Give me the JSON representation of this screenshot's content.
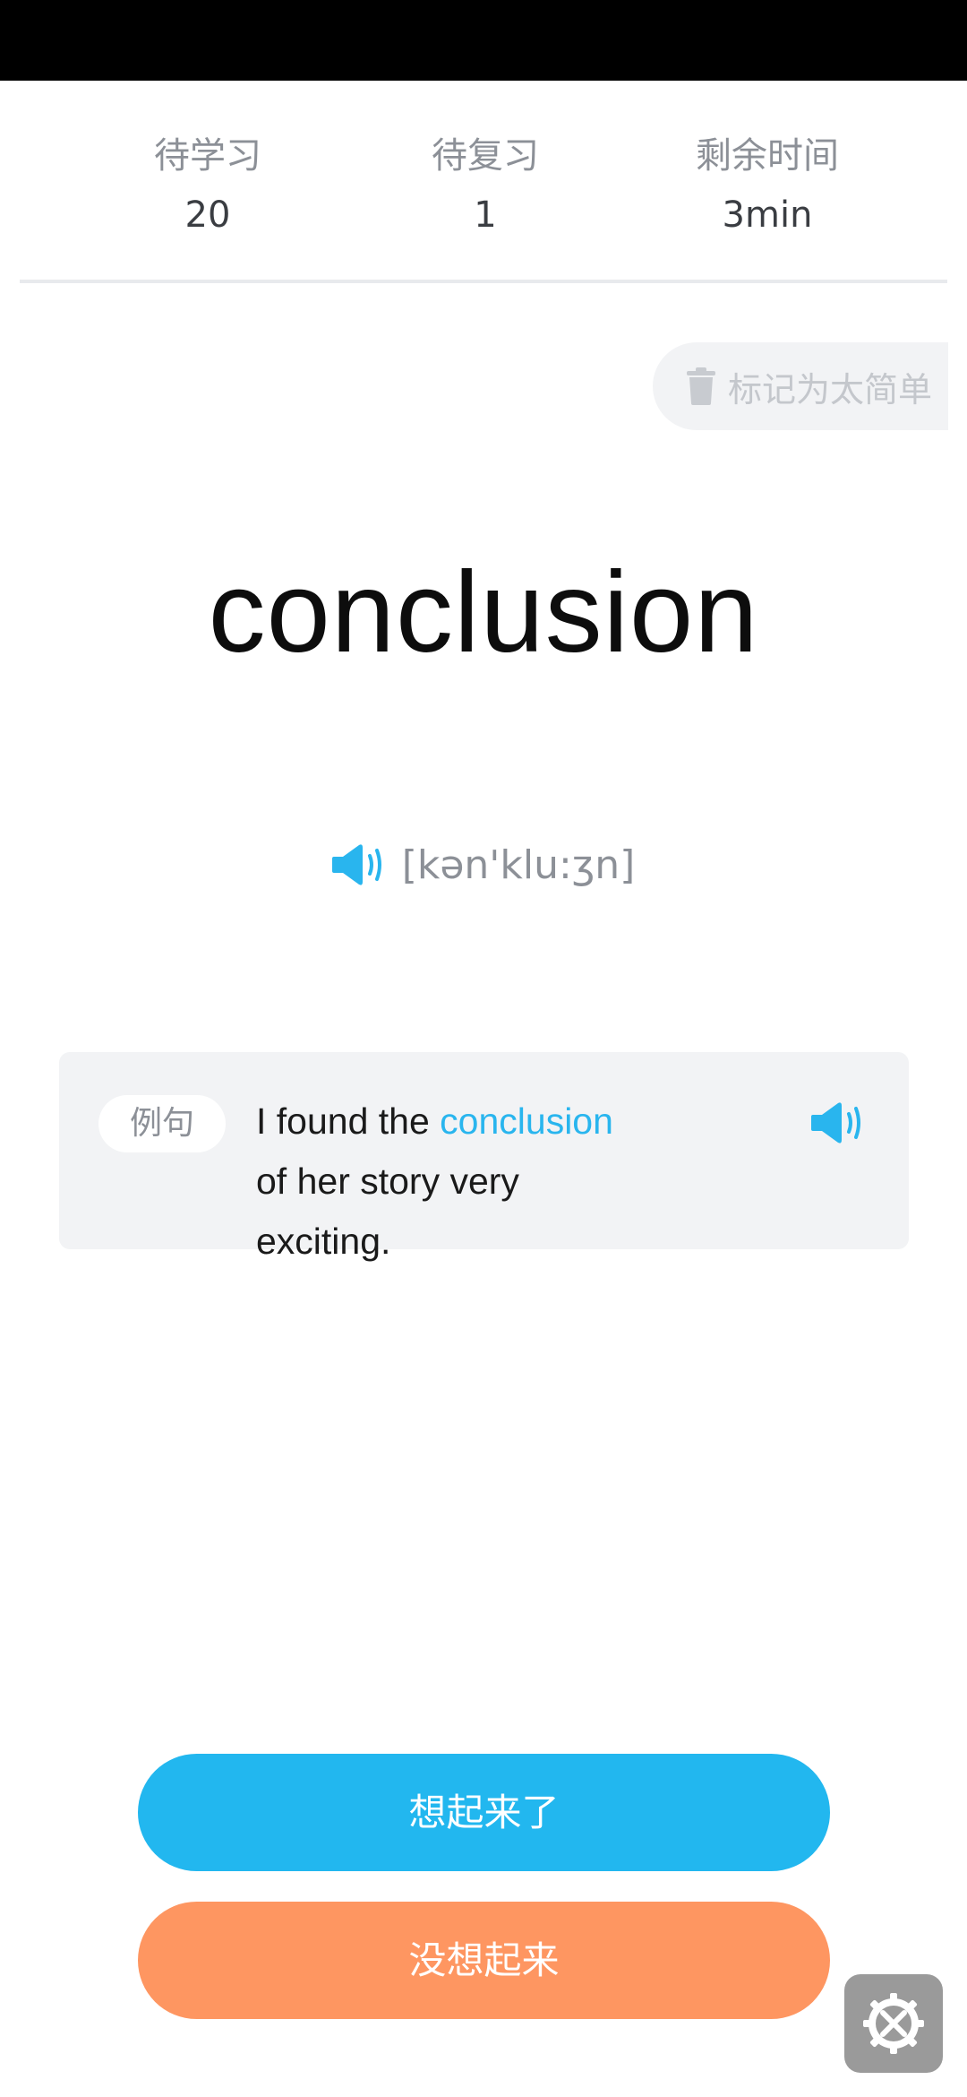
{
  "stats": [
    {
      "label": "待学习",
      "value": "20"
    },
    {
      "label": "待复习",
      "value": "1"
    },
    {
      "label": "剩余时间",
      "value": "3min"
    }
  ],
  "mark_easy": {
    "icon": "trash-icon",
    "label": "标记为太简单"
  },
  "word": {
    "text": "conclusion",
    "phonetic": "[kən'klu:ʒn]",
    "speaker_icon": "speaker-icon"
  },
  "example": {
    "tag": "例句",
    "before": "I found the ",
    "highlight": "conclusion",
    "after": " of her story very exciting.",
    "speaker_icon": "speaker-icon"
  },
  "buttons": {
    "remember": "想起来了",
    "forgot": "没想起来"
  },
  "fab": {
    "icon": "tools-icon"
  },
  "colors": {
    "accent_blue": "#22b7ef",
    "accent_orange": "#fe9661",
    "muted_text": "#8c9097",
    "card_bg": "#f2f3f5"
  }
}
